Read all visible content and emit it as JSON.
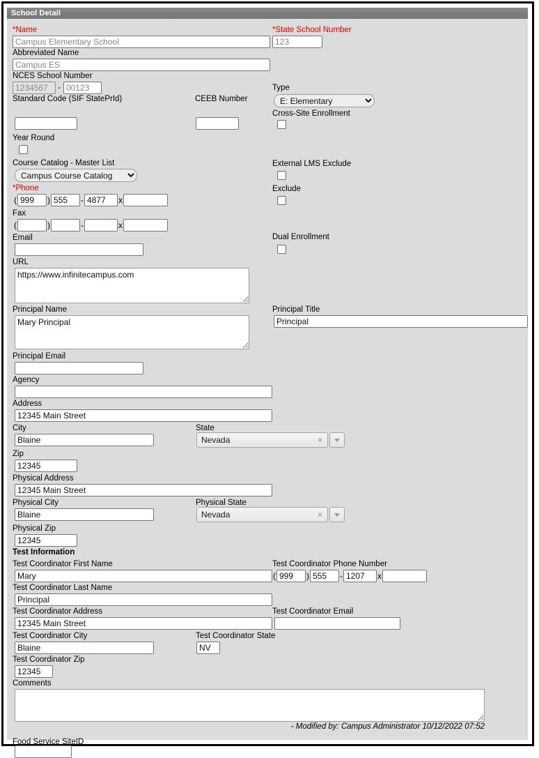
{
  "window": {
    "title": "School Detail"
  },
  "fields": {
    "name": {
      "label": "*Name",
      "value": "Campus Elementary School"
    },
    "state_school_number": {
      "label": "*State School Number",
      "value": "123"
    },
    "abbreviated_name": {
      "label": "Abbreviated Name",
      "value": "Campus ES"
    },
    "nces_school_number": {
      "label": "NCES School Number",
      "value_1": "1234567",
      "value_2": "00123",
      "separator": "-"
    },
    "type": {
      "label": "Type",
      "value": "E: Elementary",
      "options": [
        "E: Elementary"
      ]
    },
    "standard_code": {
      "label": "Standard Code (SIF StatePrId)",
      "value": ""
    },
    "ceeb_number": {
      "label": "CEEB Number",
      "value": ""
    },
    "cross_site_enrollment": {
      "label": "Cross-Site Enrollment",
      "checked": false
    },
    "year_round": {
      "label": "Year Round",
      "checked": false
    },
    "course_catalog": {
      "label": "Course Catalog - Master List",
      "value": "Campus Course Catalog",
      "options": [
        "Campus Course Catalog"
      ]
    },
    "external_lms_exclude": {
      "label": "External LMS Exclude",
      "checked": false
    },
    "exclude": {
      "label": "Exclude",
      "checked": false
    },
    "phone": {
      "label": "*Phone",
      "area": "999",
      "prefix": "555",
      "line": "4877",
      "ext": ""
    },
    "fax": {
      "label": "Fax",
      "area": "",
      "prefix": "",
      "line": "",
      "ext": ""
    },
    "email": {
      "label": "Email",
      "value": ""
    },
    "dual_enrollment": {
      "label": "Dual Enrollment",
      "checked": false
    },
    "url": {
      "label": "URL",
      "value": "https://www.infinitecampus.com"
    },
    "principal_name": {
      "label": "Principal Name",
      "value": "Mary Principal"
    },
    "principal_title": {
      "label": "Principal Title",
      "value": "Principal"
    },
    "principal_email": {
      "label": "Principal Email",
      "value": ""
    },
    "agency": {
      "label": "Agency",
      "value": ""
    },
    "address": {
      "label": "Address",
      "value": "12345 Main Street"
    },
    "city": {
      "label": "City",
      "value": "Blaine"
    },
    "state": {
      "label": "State",
      "value": "Nevada",
      "clear_icon": "×"
    },
    "zip": {
      "label": "Zip",
      "value": "12345"
    },
    "physical_address": {
      "label": "Physical Address",
      "value": "12345 Main Street"
    },
    "physical_city": {
      "label": "Physical City",
      "value": "Blaine"
    },
    "physical_state": {
      "label": "Physical State",
      "value": "Nevada",
      "clear_icon": "×"
    },
    "physical_zip": {
      "label": "Physical Zip",
      "value": "12345"
    },
    "test_information": {
      "label": "Test Information"
    },
    "tc_first_name": {
      "label": "Test Coordinator First Name",
      "value": "Mary"
    },
    "tc_phone": {
      "label": "Test Coordinator Phone Number",
      "area": "999",
      "prefix": "555",
      "line": "1207",
      "ext": ""
    },
    "tc_last_name": {
      "label": "Test Coordinator Last Name",
      "value": "Principal"
    },
    "tc_address": {
      "label": "Test Coordinator Address",
      "value": "12345 Main Street"
    },
    "tc_email": {
      "label": "Test Coordinator Email",
      "value": ""
    },
    "tc_city": {
      "label": "Test Coordinator City",
      "value": "Blaine"
    },
    "tc_state": {
      "label": "Test Coordinator State",
      "value": "NV"
    },
    "tc_zip": {
      "label": "Test Coordinator Zip",
      "value": "12345"
    },
    "comments": {
      "label": "Comments",
      "value": ""
    },
    "food_service_siteid": {
      "label": "Food Service SiteID",
      "value": ""
    }
  },
  "footer": {
    "modified": "- Modified by: Campus Administrator 10/12/2022 07:52"
  },
  "colors": {
    "required": "#e00000",
    "titlebar": "#7d7d7d",
    "panel": "#dcdcdc"
  }
}
